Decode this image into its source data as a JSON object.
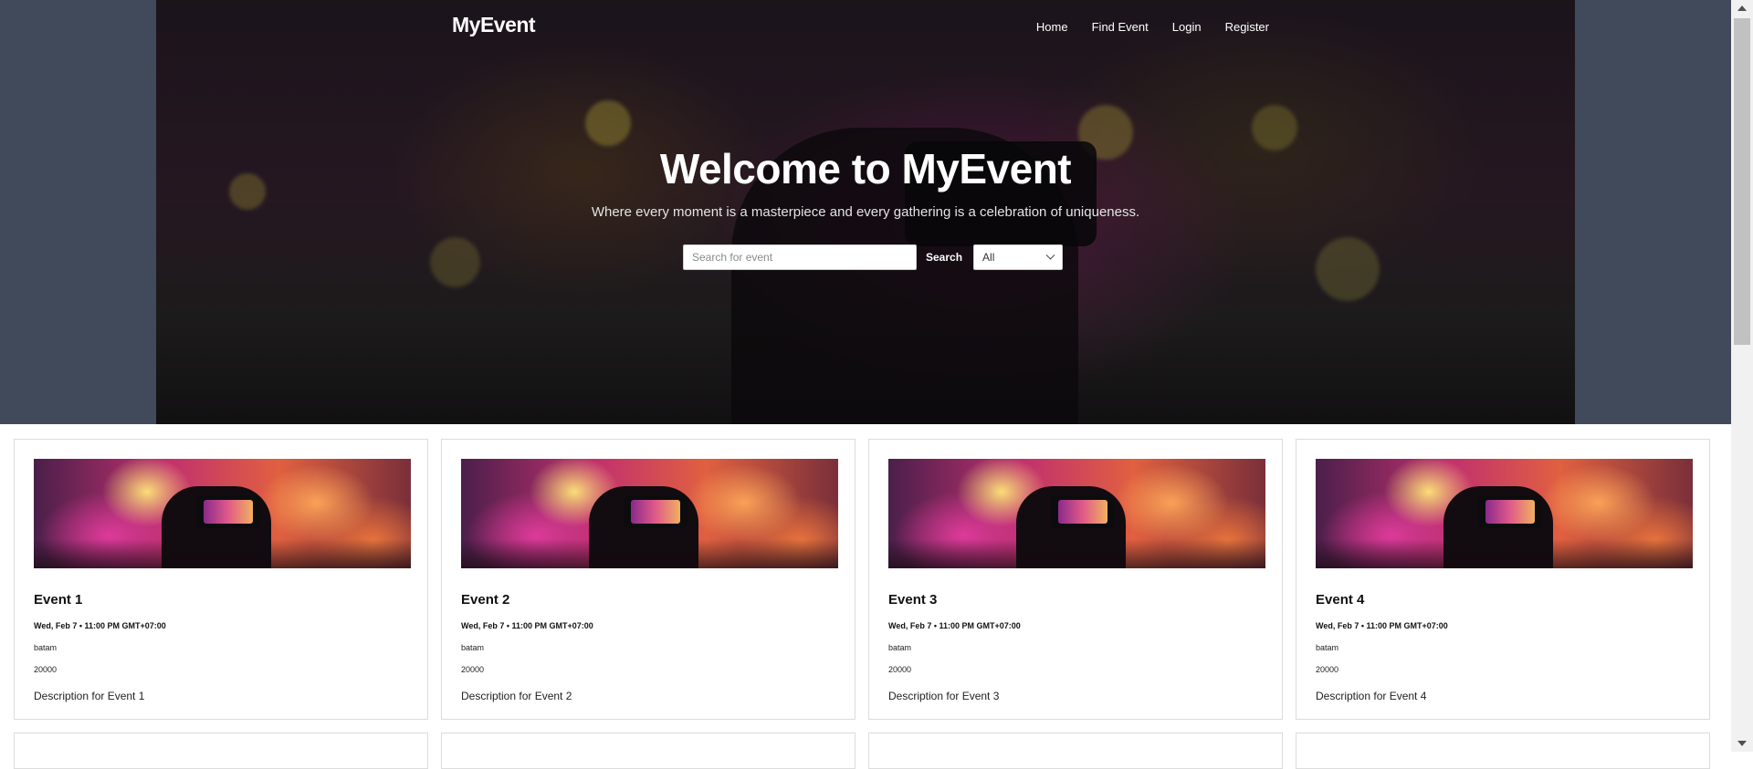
{
  "brand": "MyEvent",
  "nav": {
    "items": [
      "Home",
      "Find Event",
      "Login",
      "Register"
    ]
  },
  "hero": {
    "title": "Welcome to MyEvent",
    "subtitle": "Where every moment is a masterpiece and every gathering is a celebration of uniqueness."
  },
  "search": {
    "placeholder": "Search for event",
    "value": "",
    "button_label": "Search",
    "filter_selected": "All"
  },
  "events": [
    {
      "title": "Event 1",
      "date": "Wed, Feb 7 • 11:00 PM GMT+07:00",
      "location": "batam",
      "price": "20000",
      "description": "Description for Event 1"
    },
    {
      "title": "Event 2",
      "date": "Wed, Feb 7 • 11:00 PM GMT+07:00",
      "location": "batam",
      "price": "20000",
      "description": "Description for Event 2"
    },
    {
      "title": "Event 3",
      "date": "Wed, Feb 7 • 11:00 PM GMT+07:00",
      "location": "batam",
      "price": "20000",
      "description": "Description for Event 3"
    },
    {
      "title": "Event 4",
      "date": "Wed, Feb 7 • 11:00 PM GMT+07:00",
      "location": "batam",
      "price": "20000",
      "description": "Description for Event 4"
    }
  ],
  "icons": {
    "select_chevron": "chevron-down-icon",
    "scroll_up": "arrow-up-icon",
    "scroll_down": "arrow-down-icon"
  },
  "colors": {
    "page_band": "#404a5a",
    "hero_text": "#ffffff",
    "card_border": "#dcdcdc"
  }
}
